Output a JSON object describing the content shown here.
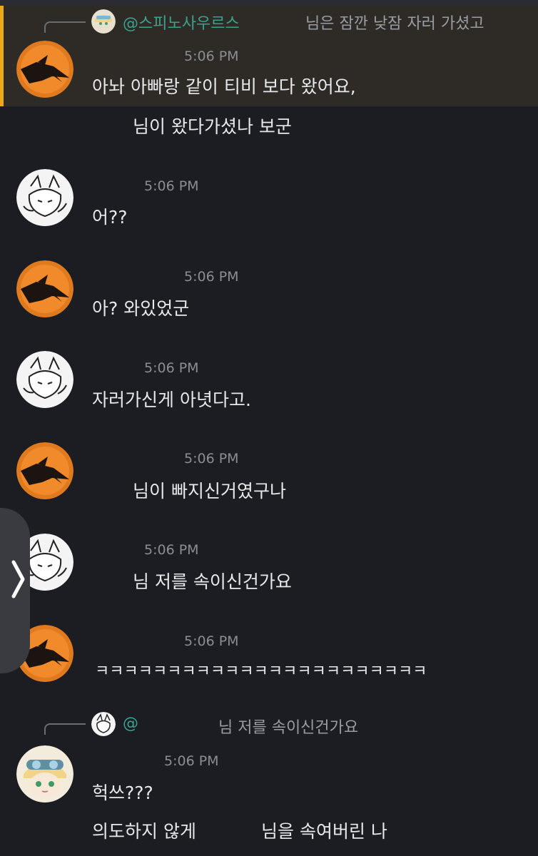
{
  "reply_top": {
    "username": "@스피노사우르스",
    "snippet": "님은 잠깐 낮잠 자러 가셨고"
  },
  "messages": [
    {
      "avatar": "orange-dragon-avatar",
      "time": "5:06 PM",
      "lines": [
        "아놔 아빠랑 같이 티비 보다 왔어요,",
        "님이 왔다가셨나 보군"
      ]
    },
    {
      "avatar": "white-cat-avatar",
      "time": "5:06 PM",
      "lines": [
        "어??"
      ]
    },
    {
      "avatar": "orange-dragon-avatar",
      "time": "5:06 PM",
      "lines": [
        "아? 와있었군"
      ]
    },
    {
      "avatar": "white-cat-avatar",
      "time": "5:06 PM",
      "lines": [
        "자러가신게 아녓다고."
      ]
    },
    {
      "avatar": "orange-dragon-avatar",
      "time": "5:06 PM",
      "lines": [
        "님이 빠지신거였구나"
      ]
    },
    {
      "avatar": "white-cat-avatar",
      "time": "5:06 PM",
      "lines": [
        "님 저를 속이신건가요"
      ]
    },
    {
      "avatar": "orange-dragon-avatar",
      "time": "5:06 PM",
      "lines": [
        "ㅋㅋㅋㅋㅋㅋㅋㅋㅋㅋㅋㅋㅋㅋㅋㅋㅋㅋㅋㅋㅋㅋㅋ"
      ]
    },
    {
      "avatar": "goggles-girl-avatar",
      "time": "5:06 PM",
      "lines": [
        "헉쓰???",
        "의도하지 않게",
        "님을 속여버린 나"
      ]
    }
  ],
  "reply_bottom": {
    "username": "@",
    "snippet": "님 저를 속이신건가요"
  },
  "colors": {
    "background": "#1c1d22",
    "highlight": "#2e2b27",
    "highlight_bar": "#e8a91a",
    "mention": "#3aa28c",
    "timestamp": "#8b8d94"
  },
  "side_tab": {
    "icon": "chevron-right-icon"
  }
}
